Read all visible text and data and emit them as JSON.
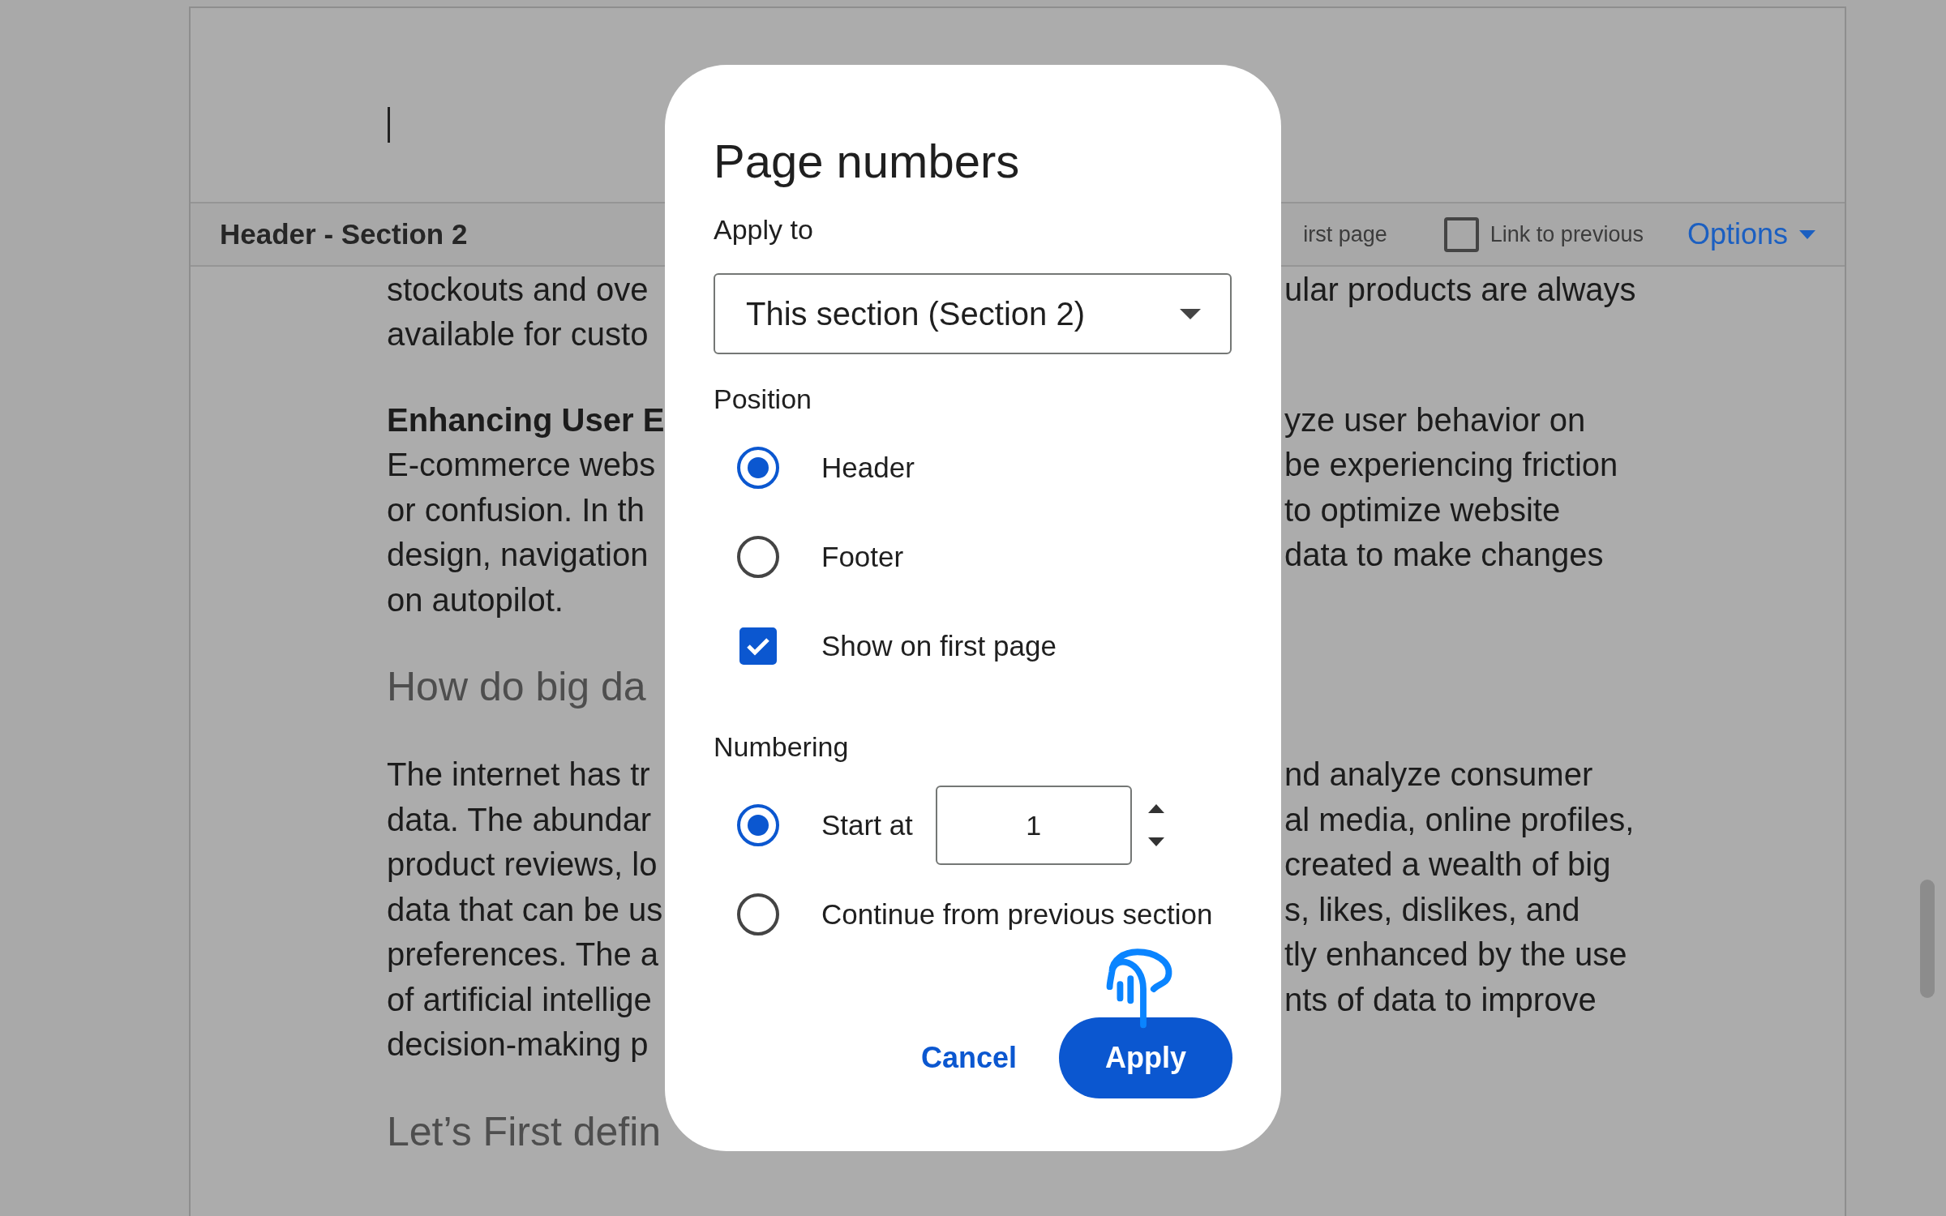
{
  "document": {
    "header_label": "Header - Section 2",
    "toolbar": {
      "first_page_label": "irst page",
      "link_to_previous": {
        "label": "Link to previous",
        "checked": false
      },
      "options": "Options"
    },
    "paragraphs": [
      {
        "kind": "body",
        "lines": [
          {
            "left": "stockouts and ove",
            "right": "ular products are always"
          },
          {
            "left": "available for custo"
          }
        ]
      },
      {
        "kind": "body",
        "lines": [
          {
            "left": "**Enhancing User E**",
            "right": "yze user behavior on"
          },
          {
            "left": "E-commerce webs",
            "right": "be experiencing friction"
          },
          {
            "left": "or confusion. In th",
            "right": "to optimize website"
          },
          {
            "left": "design, navigation",
            "right": "data to make changes"
          },
          {
            "left": "on autopilot."
          }
        ]
      },
      {
        "kind": "heading",
        "lines": [
          {
            "left": "How do big da"
          }
        ]
      },
      {
        "kind": "body",
        "lines": [
          {
            "left": "The internet has tr",
            "right": "nd analyze consumer"
          },
          {
            "left": "data. The abundar",
            "right": "al media, online profiles,"
          },
          {
            "left": "product reviews, lo",
            "right": "created a wealth of big"
          },
          {
            "left": "data that can be us",
            "right": "s, likes, dislikes, and"
          },
          {
            "left": "preferences. The a",
            "right": "tly enhanced by the use"
          },
          {
            "left": "of artificial intellige",
            "right": "nts of data to improve"
          },
          {
            "left": "decision-making p"
          }
        ]
      },
      {
        "kind": "heading",
        "lines": [
          {
            "left": "Let’s First defin"
          }
        ]
      }
    ]
  },
  "dialog": {
    "title": "Page numbers",
    "apply_to": {
      "label": "Apply to",
      "value": "This section (Section 2)"
    },
    "position": {
      "label": "Position",
      "options": [
        {
          "label": "Header",
          "selected": true
        },
        {
          "label": "Footer",
          "selected": false
        }
      ]
    },
    "show_on_first_page": {
      "label": "Show on first page",
      "checked": true
    },
    "numbering": {
      "label": "Numbering",
      "options": [
        {
          "label": "Start at",
          "selected": true
        },
        {
          "label": "Continue from previous section",
          "selected": false
        }
      ],
      "start_value": "1"
    },
    "buttons": {
      "cancel": "Cancel",
      "apply": "Apply"
    }
  }
}
